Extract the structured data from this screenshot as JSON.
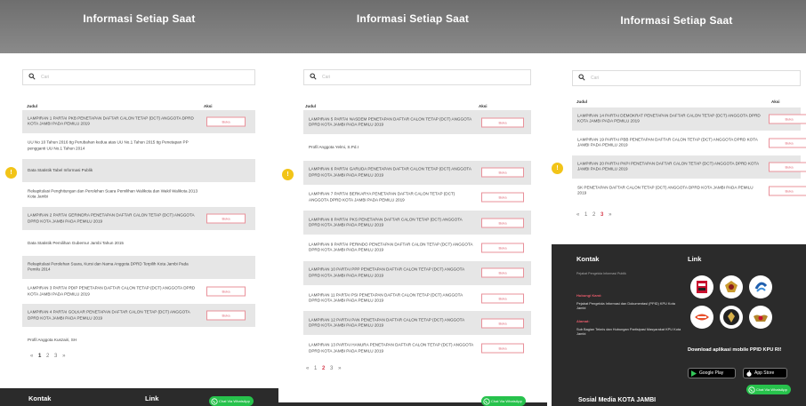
{
  "header_title": "Informasi Setiap Saat",
  "search_placeholder": "Cari",
  "col_judul": "Judul",
  "col_aksi": "Aksi",
  "button_label": "Buka",
  "side_tab_icon": "info-icon",
  "panel1": {
    "rows": [
      {
        "text": "LAMPIRAN 1 PARTAI PKB PENETAPAN DAFTAR CALON TETAP (DCT) ANGGOTA DPRD KOTA JAMBI PADA PEMILU 2019",
        "button": true
      },
      {
        "text": "UU No 10 Tahun 2016 ttg Perubahan kedua atas UU No.1 Tahun 2015 ttg Penetapan PP pengganti UU No.1 Tahun 2014",
        "button": false
      },
      {
        "text": "Data Statistik Tabel Informasi Publik",
        "button": false
      },
      {
        "text": "Rekapitulasi Penghitungan dan Perolehan Suara Pemilihan Walikota dan Wakil Walikota 2013 Kota Jambi",
        "button": false
      },
      {
        "text": "LAMPIRAN 2 PARTAI GERINDRA PENETAPAN DAFTAR CALON TETAP (DCT) ANGGOTA DPRD KOTA JAMBI PADA PEMILU 2019",
        "button": true
      },
      {
        "text": "Data Statistik Pemilihan Gubernur Jambi Tahun 2015",
        "button": false
      },
      {
        "text": "Rekapitulasi Perolehan Suara, Kursi dan Nama Anggota DPRD Terpilih Kota Jambi Pada Pemilu 2014",
        "button": false
      },
      {
        "text": "LAMPIRAN 3 PARTAI PDIP PENETAPAN DAFTAR CALON TETAP (DCT) ANGGOTA DPRD KOTA JAMBI PADA PEMILU 2019",
        "button": true
      },
      {
        "text": "LAMPIRAN 4 PARTAI GOLKAR PENETAPAN DAFTAR CALON TETAP (DCT) ANGGOTA DPRD KOTA JAMBI PADA PEMILU 2019",
        "button": true
      },
      {
        "text": "Profil Anggota Kuszairi, SH",
        "button": false
      }
    ],
    "pager": [
      "«",
      "1",
      "2",
      "3",
      "»"
    ],
    "footer": {
      "kontak": "Kontak",
      "link": "Link"
    },
    "whatsapp": "Chat Via WhatsApp"
  },
  "panel2": {
    "rows": [
      {
        "text": "LAMPIRAN 5 PARTAI NASDEM PENETAPAN DAFTAR CALON TETAP (DCT) ANGGOTA DPRD KOTA JAMBI PADA PEMILU 2019",
        "button": true
      },
      {
        "text": "Profil Anggota Yelmi, S.Pd.I",
        "button": false
      },
      {
        "text": "LAMPIRAN 6 PARTAI GARUDA PENETAPAN DAFTAR CALON TETAP (DCT) ANGGOTA DPRD KOTA JAMBI PADA PEMILU 2019",
        "button": true
      },
      {
        "text": "LAMPIRAN 7 PARTAI BERKARYA PENETAPAN DAFTAR CALON TETAP (DCT) ANGGOTA DPRD KOTA JAMBI PADA PEMILU 2019",
        "button": true
      },
      {
        "text": "LAMPIRAN 8 PARTAI PKS PENETAPAN DAFTAR CALON TETAP (DCT) ANGGOTA DPRD KOTA JAMBI PADA PEMILU 2019",
        "button": true
      },
      {
        "text": "LAMPIRAN 9 PARTAI PERINDO PENETAPAN DAFTAR CALON TETAP (DCT) ANGGOTA DPRD KOTA JAMBI PADA PEMILU 2019",
        "button": true
      },
      {
        "text": "LAMPIRAN 10 PARTAI PPP PENETAPAN DAFTAR CALON TETAP (DCT) ANGGOTA DPRD KOTA JAMBI PADA PEMILU 2019",
        "button": true
      },
      {
        "text": "LAMPIRAN 11 PARTAI PSI PENETAPAN DAFTAR CALON TETAP (DCT) ANGGOTA DPRD KOTA JAMBI PADA PEMILU 2019",
        "button": true
      },
      {
        "text": "LAMPIRAN 12 PARTAI PAN PENETAPAN DAFTAR CALON TETAP (DCT) ANGGOTA DPRD KOTA JAMBI PADA PEMILU 2019",
        "button": true
      },
      {
        "text": "LAMPIRAN 13 PARTAI HANURA PENETAPAN DAFTAR CALON TETAP (DCT) ANGGOTA DPRD KOTA JAMBI PADA PEMILU 2019",
        "button": true
      }
    ],
    "pager": [
      "«",
      "1",
      "2",
      "3",
      "»"
    ],
    "whatsapp": "Chat Via WhatsApp"
  },
  "panel3": {
    "rows": [
      {
        "text": "LAMPIRAN 14 PARTAI DEMOKRAT PENETAPAN DAFTAR CALON TETAP (DCT) ANGGOTA DPRD KOTA JAMBI PADA PEMILU 2019",
        "button": true
      },
      {
        "text": "LAMPIRAN 19 PARTAI PBB PENETAPAN DAFTAR CALON TETAP (DCT) ANGGOTA DPRD KOTA JAMBI PADA PEMILU 2019",
        "button": true
      },
      {
        "text": "LAMPIRAN 20 PARTAI PKPI PENETAPAN DAFTAR CALON TETAP (DCT) ANGGOTA DPRD KOTA JAMBI PADA PEMILU 2019",
        "button": true
      },
      {
        "text": "SK PENETAPAN DAFTAR CALON TETAP (DCT) ANGGOTA DPRD KOTA JAMBI PADA PEMILU 2019",
        "button": true
      }
    ],
    "pager": [
      "«",
      "1",
      "2",
      "3",
      "»"
    ],
    "footer": {
      "kontak": "Kontak",
      "link": "Link",
      "subtitle": "Pejabat Pengelola Informasi Publik",
      "hubungi_label": "Hubungi Kami:",
      "hubungi_text": "Pejabat Pengelola Informasi dan Dokumentasi (PPID) KPU Kota Jambi",
      "alamat_label": "Alamat:",
      "alamat_text": "Sub Bagian Teknis dan Hubungan Partisipasi Masyarakat KPU Kota Jambi",
      "app_title": "Download aplikasi mobile PPID KPU RI!",
      "google_play": "Google Play",
      "app_store": "App Store",
      "sosmed": "Sosial Media KOTA JAMBI",
      "logos": [
        "kpu-logo-icon",
        "garuda-emblem-icon",
        "ri-logo-icon",
        "jdih-logo-icon",
        "bawaslu-logo-icon",
        "garuda-seal-icon"
      ]
    },
    "whatsapp": "Chat Via WhatsApp"
  },
  "colors": {
    "accent_red": "#e06a78",
    "whatsapp_green": "#27c24c",
    "footer_bg": "#2b2b2b",
    "header_grey": "#7a7a7a",
    "info_yellow": "#f2c418"
  }
}
